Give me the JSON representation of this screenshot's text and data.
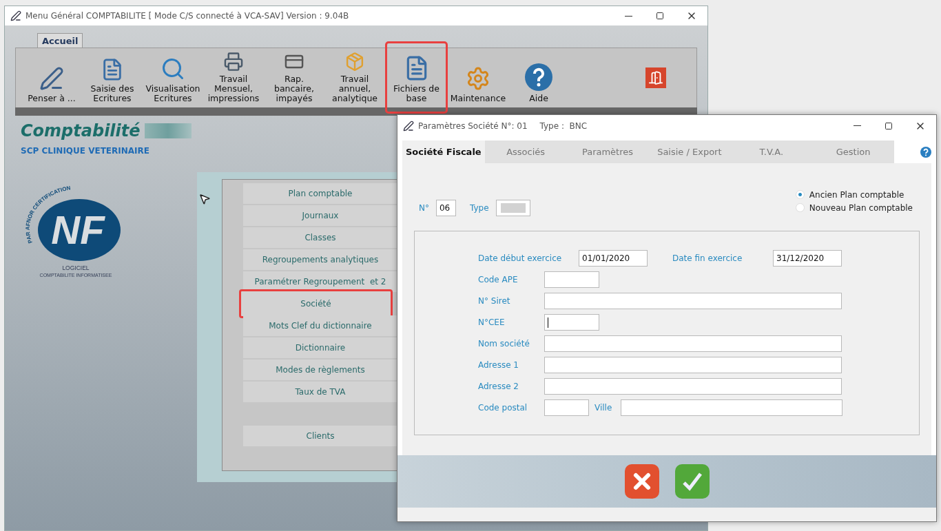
{
  "main_window": {
    "title": "Menu Général COMPTABILITE [ Mode C/S connecté à VCA-SAV] Version : 9.04B",
    "tabs": [
      {
        "label": "Accueil",
        "selected": true
      }
    ],
    "toolbar": [
      {
        "label": "Penser à ...",
        "highlighted": false
      },
      {
        "label": "Saisie des\nEcritures",
        "highlighted": false
      },
      {
        "label": "Visualisation\nEcritures",
        "highlighted": false
      },
      {
        "label": "Travail\nMensuel,\nimpressions",
        "highlighted": false
      },
      {
        "label": "Rap.\nbancaire,\nimpayés",
        "highlighted": false
      },
      {
        "label": "Travail\nannuel,\nanalytique",
        "highlighted": false
      },
      {
        "label": "Fichiers de\nbase",
        "highlighted": true
      },
      {
        "label": "Maintenance",
        "highlighted": false
      },
      {
        "label": "Aide",
        "highlighted": false
      }
    ],
    "heading": "Comptabilité",
    "subtitle": "SCP CLINIQUE VETERINAIRE",
    "logo": {
      "mark": "NF",
      "arc": "PAR AFNOR CERTIFICATION",
      "line1": "LOGICIEL",
      "line2": "COMPTABILITE INFORMATISEE"
    },
    "menu": [
      {
        "kind": "item",
        "label": "Plan comptable",
        "highlighted": false
      },
      {
        "kind": "item",
        "label": "Journaux",
        "highlighted": false
      },
      {
        "kind": "item",
        "label": "Classes",
        "highlighted": false
      },
      {
        "kind": "item",
        "label": "Regroupements analytiques",
        "highlighted": false
      },
      {
        "kind": "item",
        "label": "Paramétrer Regroupement  et 2",
        "highlighted": false
      },
      {
        "kind": "item",
        "label": "Société",
        "highlighted": true
      },
      {
        "kind": "item",
        "label": "Mots Clef du dictionnaire",
        "highlighted": false
      },
      {
        "kind": "item",
        "label": "Dictionnaire",
        "highlighted": false
      },
      {
        "kind": "item",
        "label": "Modes de règlements",
        "highlighted": false
      },
      {
        "kind": "item",
        "label": "Taux de TVA",
        "highlighted": false
      },
      {
        "kind": "blank"
      },
      {
        "kind": "item",
        "label": "Clients",
        "highlighted": false
      }
    ]
  },
  "dialog": {
    "title": "Paramètres Société N°: 01",
    "type_info": "Type :  BNC",
    "tabs": [
      {
        "label": "Société Fiscale",
        "selected": true
      },
      {
        "label": "Associés",
        "selected": false
      },
      {
        "label": "Paramètres",
        "selected": false
      },
      {
        "label": "Saisie / Export",
        "selected": false
      },
      {
        "label": "T.V.A.",
        "selected": false
      },
      {
        "label": "Gestion",
        "selected": false
      }
    ],
    "number": {
      "label": "N°",
      "value": "06"
    },
    "type": {
      "label": "Type"
    },
    "plan_options": [
      {
        "label": "Ancien Plan comptable",
        "selected": true
      },
      {
        "label": "Nouveau Plan comptable",
        "selected": false
      }
    ],
    "rows": [
      {
        "fields": [
          {
            "label": "Date début exercice",
            "kind": "date",
            "value": "01/01/2020",
            "focused": false
          },
          {
            "label": "Date fin exercice",
            "kind": "date",
            "value": "31/12/2020",
            "focused": false
          }
        ]
      },
      {
        "fields": [
          {
            "label": "Code APE",
            "kind": "short",
            "focused": false
          }
        ]
      },
      {
        "fields": [
          {
            "label": "N° Siret",
            "kind": "wide",
            "focused": false
          }
        ]
      },
      {
        "fields": [
          {
            "label": "N°CEE",
            "kind": "short",
            "focused": true
          }
        ]
      },
      {
        "fields": [
          {
            "label": "Nom société",
            "kind": "wide",
            "focused": false
          }
        ]
      },
      {
        "fields": [
          {
            "label": "Adresse 1",
            "kind": "wide",
            "focused": false
          }
        ]
      },
      {
        "fields": [
          {
            "label": "Adresse 2",
            "kind": "wide",
            "focused": false
          }
        ]
      },
      {
        "fields": [
          {
            "label": "Code postal",
            "kind": "postal",
            "focused": false
          },
          {
            "label": "Ville",
            "kind": "city",
            "focused": false
          }
        ]
      }
    ]
  }
}
